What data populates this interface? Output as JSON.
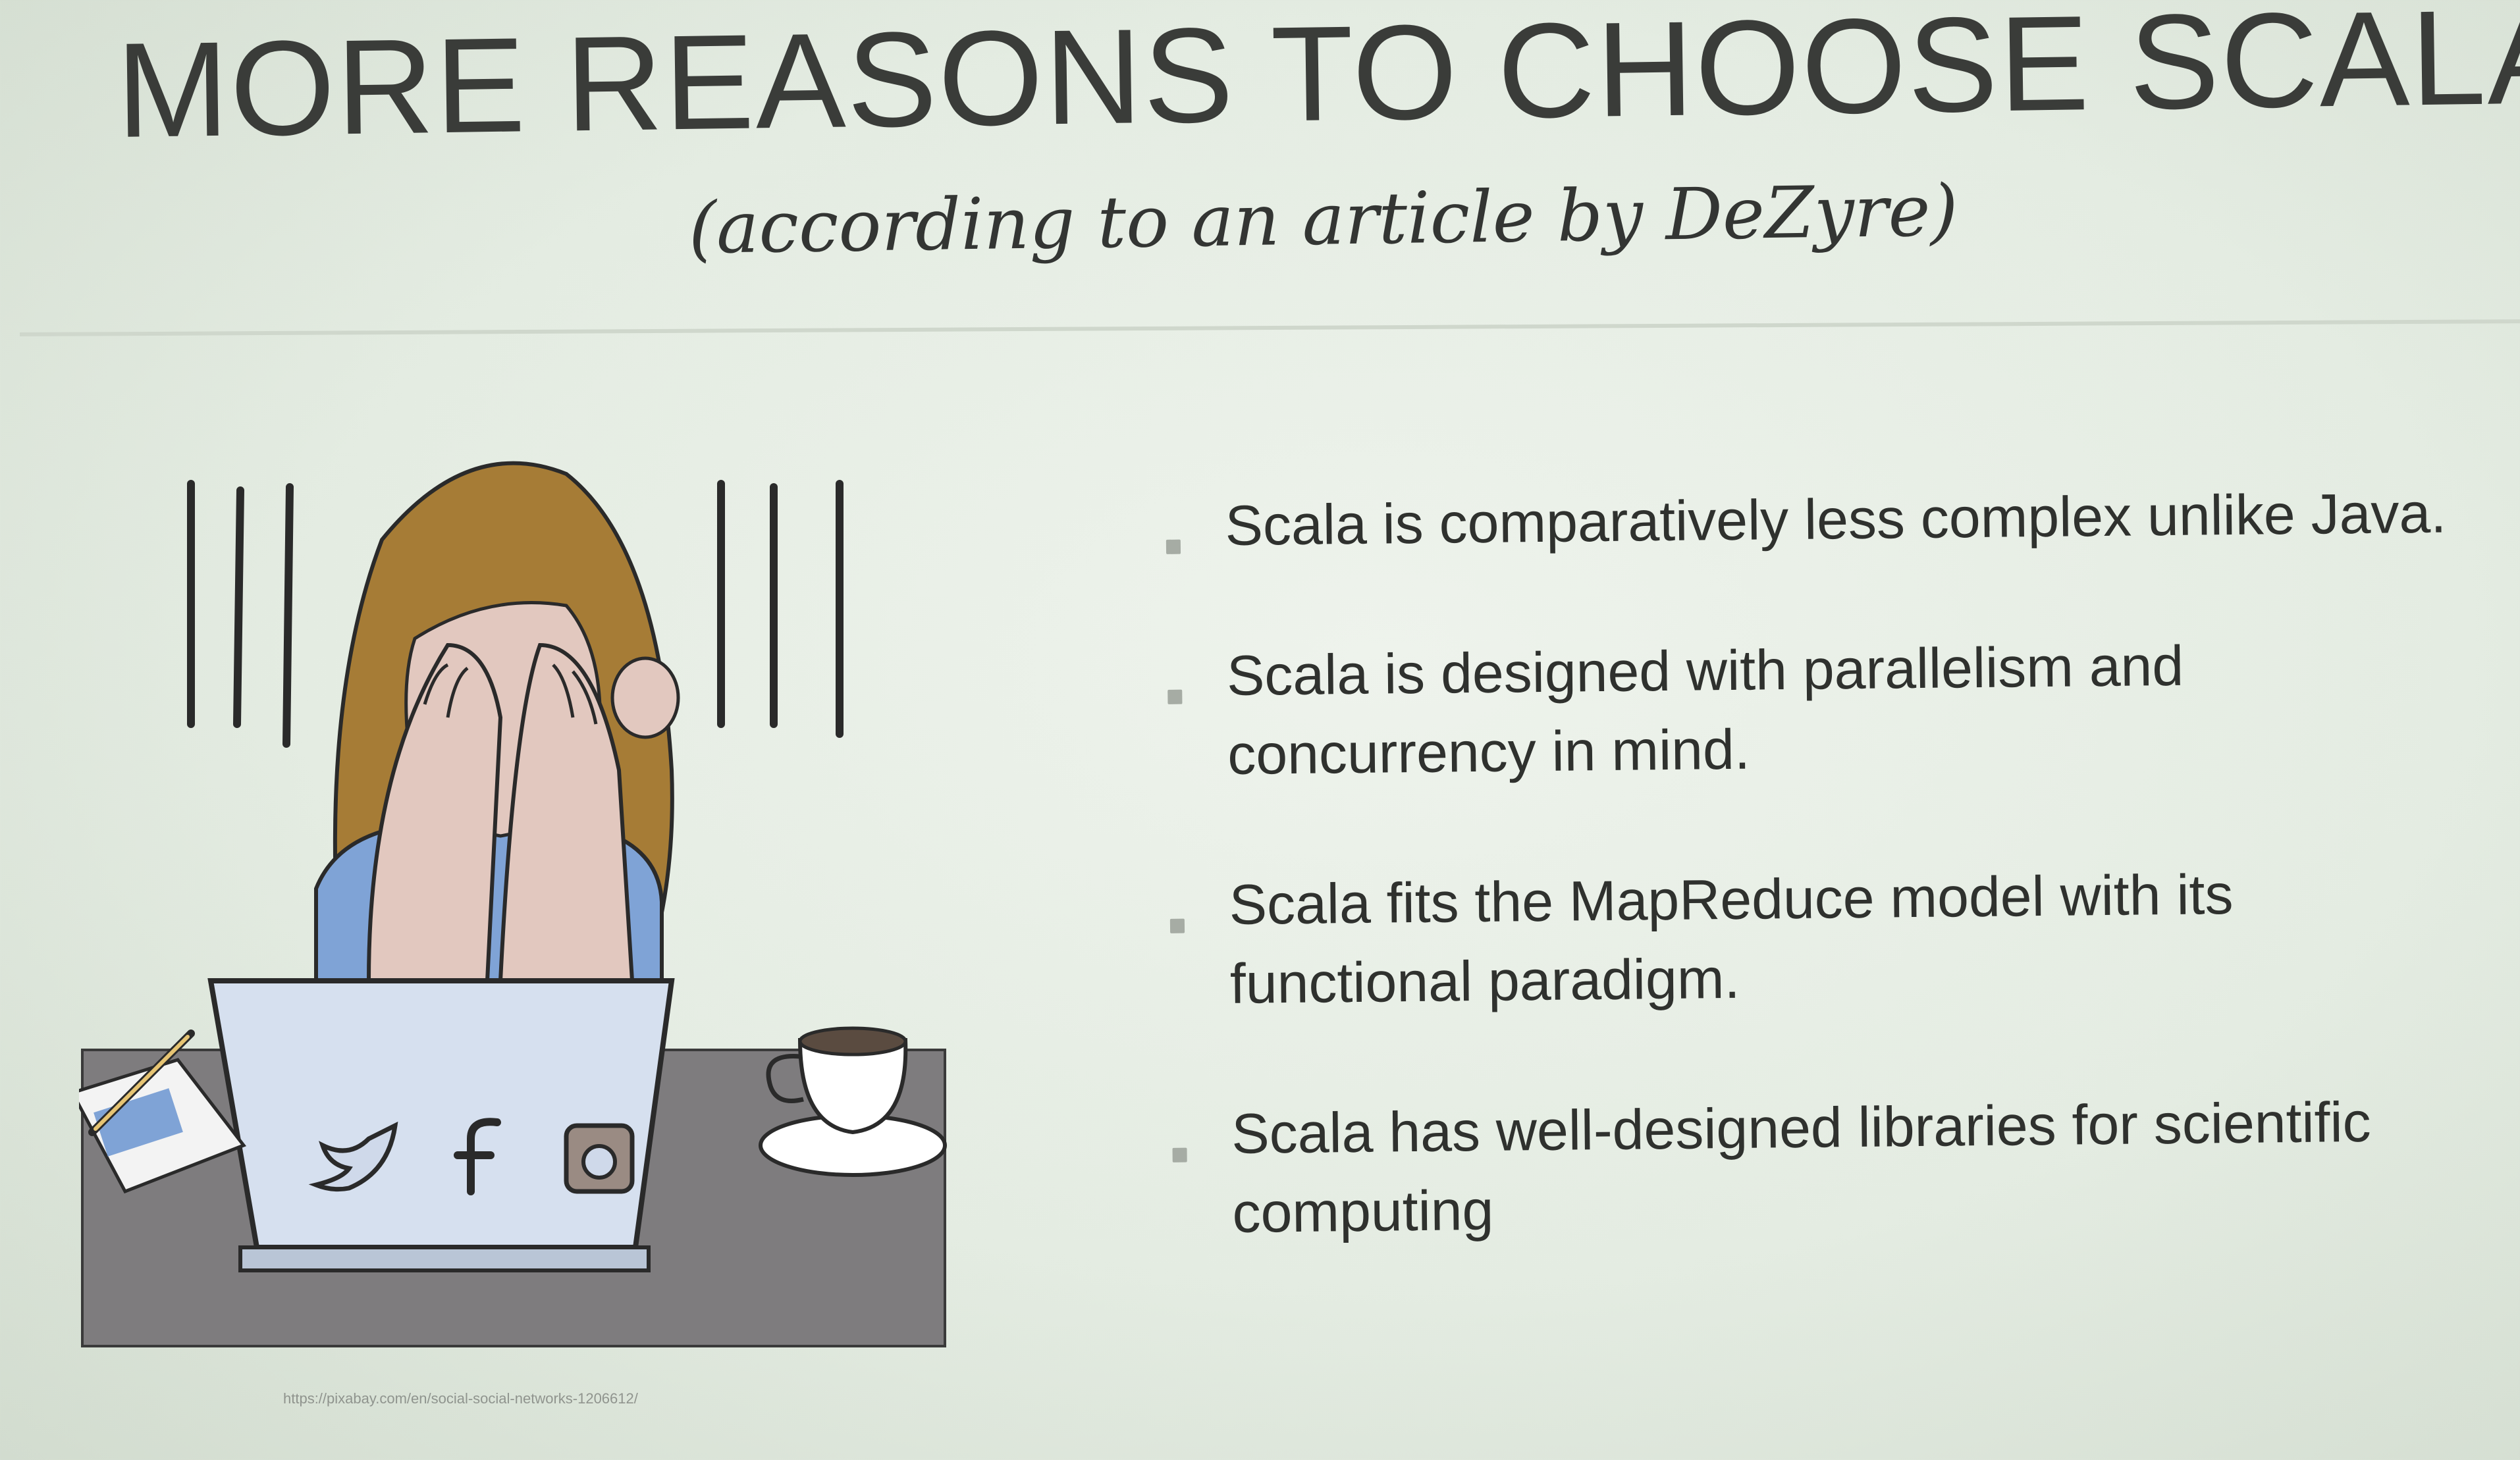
{
  "slide": {
    "title": "MORE REASONS TO CHOOSE SCALA",
    "subtitle": "(according to an article by DeZyre)"
  },
  "bullets": [
    "Scala is comparatively less complex unlike Java.",
    "Scala is designed with parallelism and concurrency in mind.",
    "Scala fits the MapReduce model with its functional paradigm.",
    "Scala has well-designed libraries for scientific computing"
  ],
  "image": {
    "icons": [
      "twitter-icon",
      "facebook-icon",
      "instagram-icon"
    ],
    "credit": "https://pixabay.com/en/social-social-networks-1206612/"
  },
  "colors": {
    "background": "#e6ede3",
    "hair": "#a67c36",
    "laptop": "#d6e0ef",
    "desk": "#7e7c7e",
    "shirt": "#7fa3d6"
  }
}
